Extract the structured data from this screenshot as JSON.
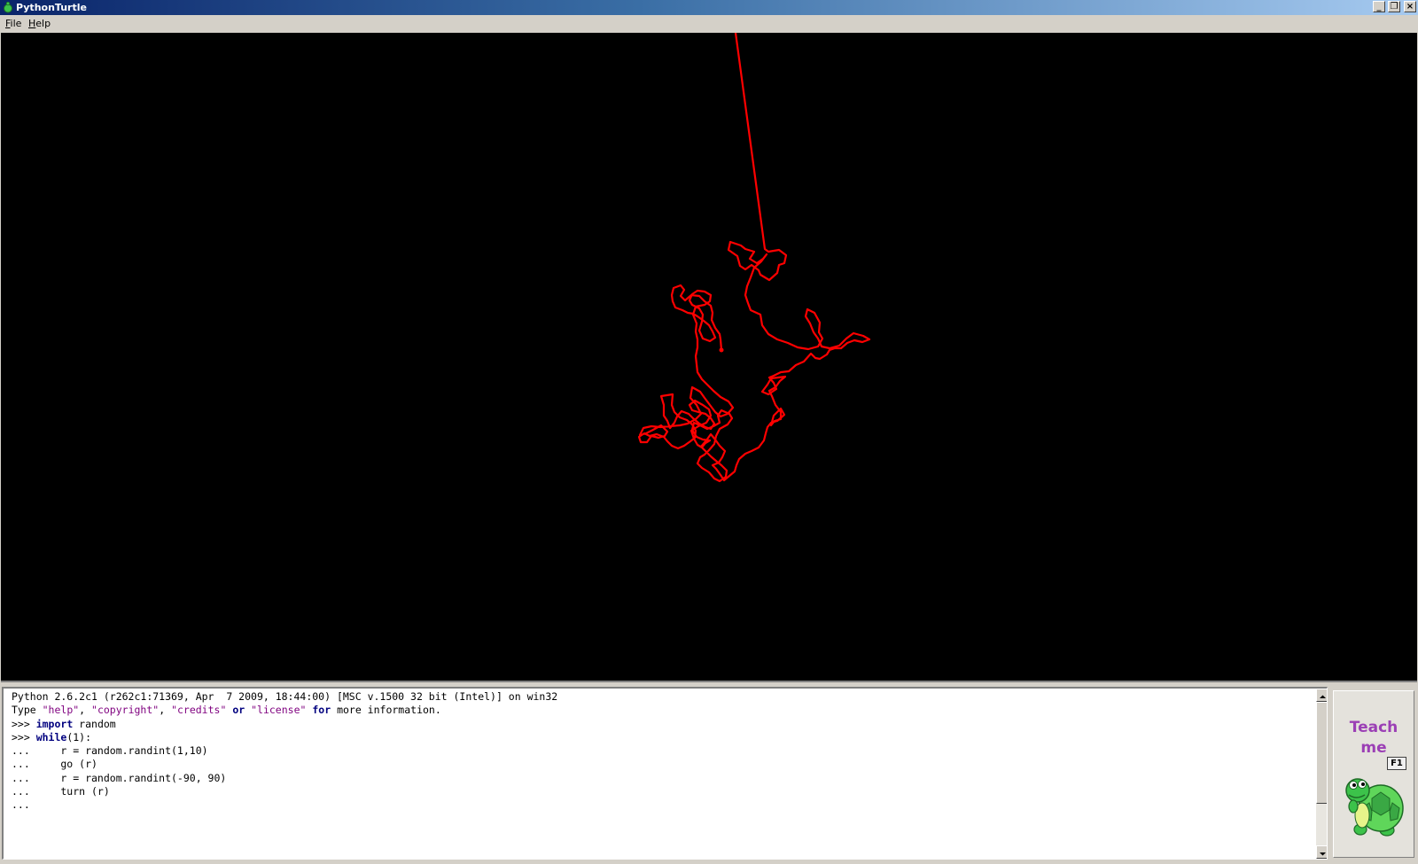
{
  "window": {
    "title": "PythonTurtle",
    "minimize_glyph": "_",
    "maximize_glyph": "❐",
    "close_glyph": "×",
    "app_icon": "turtle-icon"
  },
  "menubar": {
    "items": [
      {
        "label": "File",
        "mnemonic": "F",
        "rest": "ile"
      },
      {
        "label": "Help",
        "mnemonic": "H",
        "rest": "elp"
      }
    ]
  },
  "canvas": {
    "background": "#000000",
    "pen_color": "#ff0000"
  },
  "shell": {
    "lines": [
      [
        {
          "t": "Python 2.6.2c1 (r262c1:71369, Apr  7 2009, 18:44:00) [MSC v.1500 32 bit (Intel)] on win32",
          "c": ""
        }
      ],
      [
        {
          "t": "Type ",
          "c": ""
        },
        {
          "t": "\"help\"",
          "c": "str"
        },
        {
          "t": ", ",
          "c": ""
        },
        {
          "t": "\"copyright\"",
          "c": "str"
        },
        {
          "t": ", ",
          "c": ""
        },
        {
          "t": "\"credits\"",
          "c": "str"
        },
        {
          "t": " ",
          "c": ""
        },
        {
          "t": "or",
          "c": "kw"
        },
        {
          "t": " ",
          "c": ""
        },
        {
          "t": "\"license\"",
          "c": "str"
        },
        {
          "t": " ",
          "c": ""
        },
        {
          "t": "for",
          "c": "kw"
        },
        {
          "t": " more information.",
          "c": ""
        }
      ],
      [
        {
          "t": ">>> ",
          "c": ""
        },
        {
          "t": "import",
          "c": "kw"
        },
        {
          "t": " random",
          "c": ""
        }
      ],
      [
        {
          "t": ">>> ",
          "c": ""
        },
        {
          "t": "while",
          "c": "kw"
        },
        {
          "t": "(1):",
          "c": ""
        }
      ],
      [
        {
          "t": "...     r = random.randint(1,10)",
          "c": ""
        }
      ],
      [
        {
          "t": "...     go (r)",
          "c": ""
        }
      ],
      [
        {
          "t": "...     r = random.randint(-90, 90)",
          "c": ""
        }
      ],
      [
        {
          "t": "...     turn (r)",
          "c": ""
        }
      ],
      [
        {
          "t": "...",
          "c": ""
        }
      ]
    ]
  },
  "teach_me": {
    "line1": "Teach",
    "line2": "me",
    "shortcut": "F1",
    "mascot": "turtle-mascot-icon"
  },
  "colors": {
    "keyword": "#00007f",
    "string": "#7f007f",
    "teach_text": "#9b3fb5",
    "turtle_green": "#3cc24a"
  }
}
